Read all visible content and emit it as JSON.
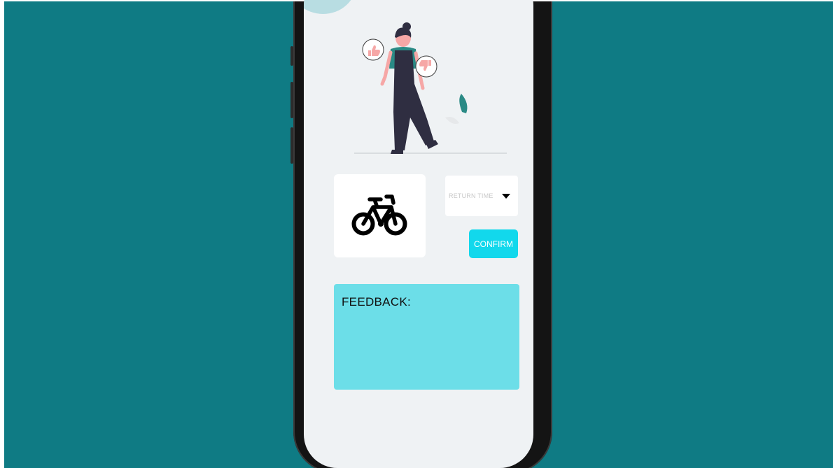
{
  "colors": {
    "backdrop": "#0f7b84",
    "phone_screen": "#eff2f4",
    "card": "#ffffff",
    "confirm_button": "#12d8ec",
    "feedback_box": "#6cdee8",
    "muted_text": "#c8c8c8",
    "blob": "#b8dde2",
    "figure_dark": "#2f2e41",
    "figure_accent": "#2a8a85",
    "figure_pink": "#f6a7a6"
  },
  "icons": {
    "bike": "bicycle-icon",
    "dropdown": "caret-down-icon",
    "illustration": "feedback-person-illustration"
  },
  "return_select": {
    "label": "RETURN TIME"
  },
  "confirm": {
    "label": "CONFIRM"
  },
  "feedback": {
    "label": "FEEDBACK:"
  }
}
